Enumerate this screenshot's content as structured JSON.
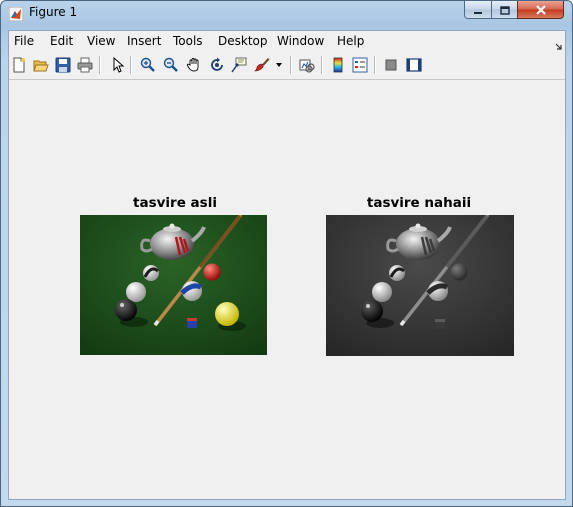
{
  "window": {
    "title": "Figure 1"
  },
  "menubar": {
    "items": [
      "File",
      "Edit",
      "View",
      "Insert",
      "Tools",
      "Desktop",
      "Window",
      "Help"
    ]
  },
  "toolbar": {
    "buttons": [
      "new-figure-icon",
      "open-file-icon",
      "save-icon",
      "print-icon",
      "edit-plot-arrow-icon",
      "zoom-in-icon",
      "zoom-out-icon",
      "pan-hand-icon",
      "rotate-3d-icon",
      "data-cursor-icon",
      "brush-icon",
      "brush-dropdown-icon",
      "link-plot-icon",
      "insert-colorbar-icon",
      "insert-legend-icon",
      "hide-plot-tools-icon",
      "show-plot-tools-icon"
    ]
  },
  "axes": [
    {
      "title": "tasvire asli",
      "image": "color billiards scene"
    },
    {
      "title": "tasvire nahaii",
      "image": "grayscale billiards scene"
    }
  ],
  "colors": {
    "felt": "#1f4e1c",
    "window_frame": "#a9c6e2",
    "client_bg": "#f0f0f0",
    "close_button": "#c23b1f"
  }
}
